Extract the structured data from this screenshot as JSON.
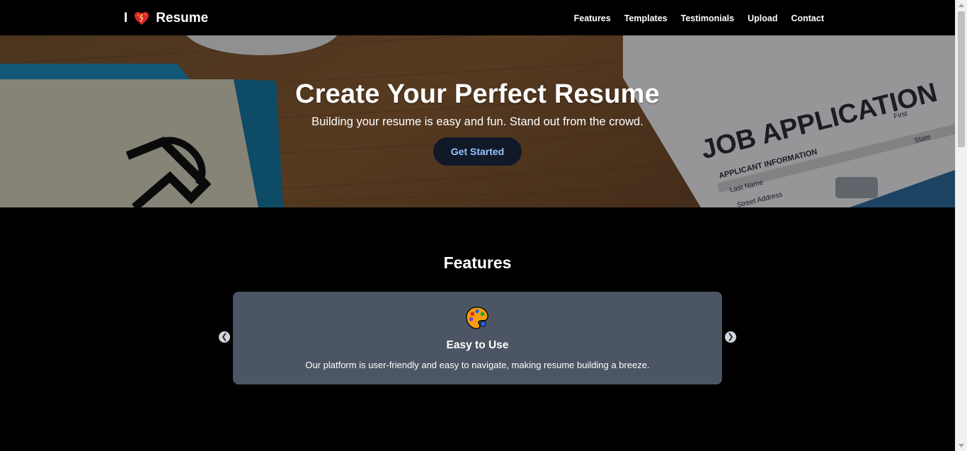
{
  "navbar": {
    "brand_prefix": "I",
    "brand_icon": "heart-icon",
    "brand_name": "Resume",
    "links": [
      {
        "label": "Features"
      },
      {
        "label": "Templates"
      },
      {
        "label": "Testimonials"
      },
      {
        "label": "Upload"
      },
      {
        "label": "Contact"
      }
    ]
  },
  "hero": {
    "title": "Create Your Perfect Resume",
    "subtitle": "Building your resume is easy and fun. Stand out from the crowd.",
    "cta_label": "Get Started",
    "background_text": {
      "heading": "JOB APPLICATION",
      "section": "APPLICANT INFORMATION",
      "fields": [
        "First",
        "Last Name",
        "State",
        "Street Address"
      ]
    }
  },
  "features": {
    "heading": "Features",
    "carousel": {
      "prev_icon": "chevron-left-icon",
      "next_icon": "chevron-right-icon",
      "current": {
        "icon": "palette-icon",
        "title": "Easy to Use",
        "description": "Our platform is user-friendly and easy to navigate, making resume building a breeze."
      }
    }
  },
  "colors": {
    "nav_bg": "#000000",
    "page_bg": "#000000",
    "card_bg": "#4b5563",
    "cta_bg": "#111827",
    "cta_text": "#93c5fd",
    "heart": "#dc2626"
  }
}
